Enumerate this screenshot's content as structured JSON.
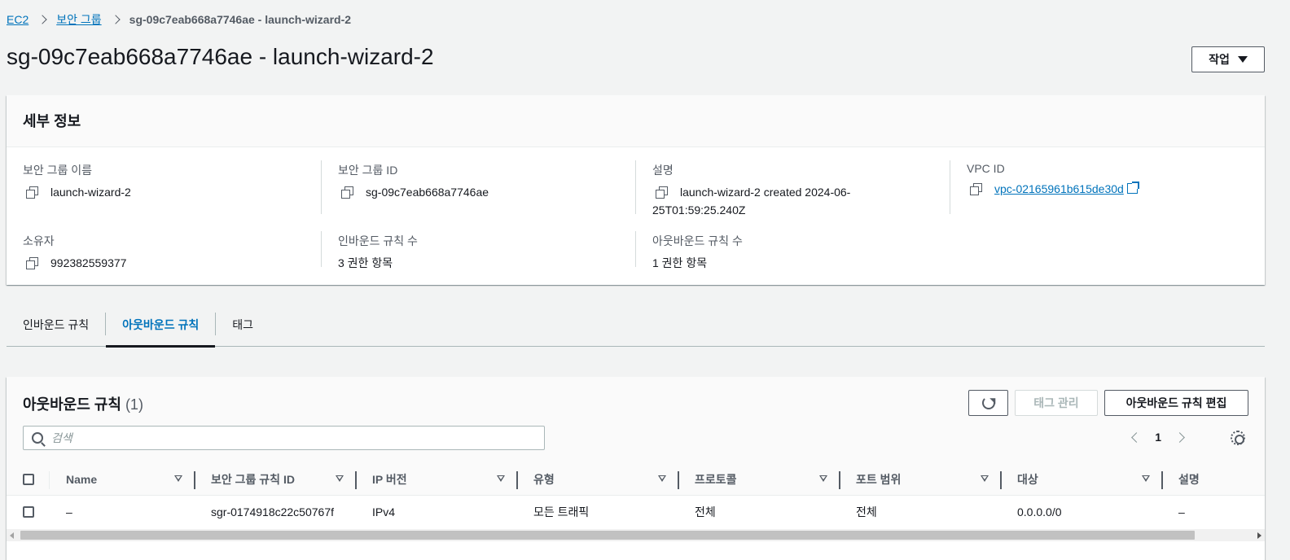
{
  "breadcrumb": {
    "root": "EC2",
    "parent": "보안 그룹",
    "current": "sg-09c7eab668a7746ae - launch-wizard-2"
  },
  "page": {
    "title": "sg-09c7eab668a7746ae - launch-wizard-2",
    "actions_label": "작업"
  },
  "details": {
    "heading": "세부 정보",
    "sg_name_label": "보안 그룹 이름",
    "sg_name": "launch-wizard-2",
    "sg_id_label": "보안 그룹 ID",
    "sg_id": "sg-09c7eab668a7746ae",
    "description_label": "설명",
    "description_line1": "launch-wizard-2 created 2024-06-",
    "description_line2": "25T01:59:25.240Z",
    "vpc_label": "VPC ID",
    "vpc_id": "vpc-02165961b615de30d",
    "owner_label": "소유자",
    "owner": "992382559377",
    "inbound_count_label": "인바운드 규칙 수",
    "inbound_count": "3 권한 항목",
    "outbound_count_label": "아웃바운드 규칙 수",
    "outbound_count": "1 권한 항목"
  },
  "tabs": [
    {
      "label": "인바운드 규칙",
      "active": false
    },
    {
      "label": "아웃바운드 규칙",
      "active": true
    },
    {
      "label": "태그",
      "active": false
    }
  ],
  "rules": {
    "title": "아웃바운드 규칙",
    "count": "(1)",
    "manage_tags_label": "태그 관리",
    "edit_label": "아웃바운드 규칙 편집",
    "search_placeholder": "검색",
    "page_number": "1",
    "columns": [
      "Name",
      "보안 그룹 규칙 ID",
      "IP 버전",
      "유형",
      "프로토콜",
      "포트 범위",
      "대상",
      "설명"
    ],
    "rows": [
      {
        "name": "–",
        "rule_id": "sgr-0174918c22c50767f",
        "ip_version": "IPv4",
        "type": "모든 트래픽",
        "protocol": "전체",
        "port_range": "전체",
        "destination": "0.0.0.0/0",
        "description": "–"
      }
    ]
  },
  "colors": {
    "link": "#0073bb",
    "text": "#16191f",
    "muted": "#545b64",
    "background": "#f2f3f3"
  }
}
